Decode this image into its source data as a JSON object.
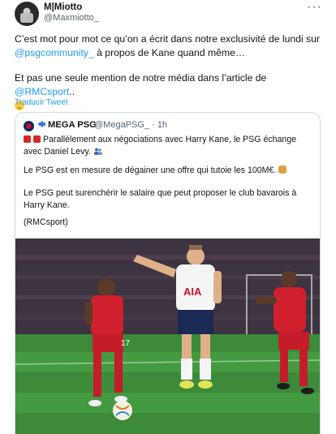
{
  "tweet": {
    "display_name": "M|Miotto",
    "handle": "@Maxmiotto_",
    "text_part1": "C’est mot pour mot ce qu’on a écrit dans notre exclusivité de lundi sur",
    "mention_psg": "@psgcommunity_",
    "text_part2": " à propos de Kane quand même…",
    "text_part3": "Et pas une seule mention de notre média dans l’article de ",
    "mention_rmc": "@RMCsport",
    "text_part4": "..",
    "translate_label": "Traducir Tweet"
  },
  "quote": {
    "display_name": "MEGA PSG",
    "handle": "@MegaPSG_",
    "time": "· 1h",
    "p1": "Parallèlement aux négociations avec Harry Kane, le PSG échange avec Daniel Levy.",
    "p2": "Le PSG est en mesure de dégainer une offre qui tutoie les 100M€.",
    "p3": "Le PSG peut surenchérir le salaire que peut proposer le club bavarois à Harry Kane.",
    "p4": "(RMCsport)"
  },
  "photo": {
    "shirt_text_aia": "AIA",
    "jersey_number": "17"
  },
  "colors": {
    "link": "#1d9bf0",
    "secondary": "#536471",
    "border": "#cfd9de"
  },
  "icons": [
    "more-icon",
    "megaphone-icon",
    "alarm-icon",
    "people-icon",
    "money-bag-icon",
    "upside-down-face-icon"
  ]
}
